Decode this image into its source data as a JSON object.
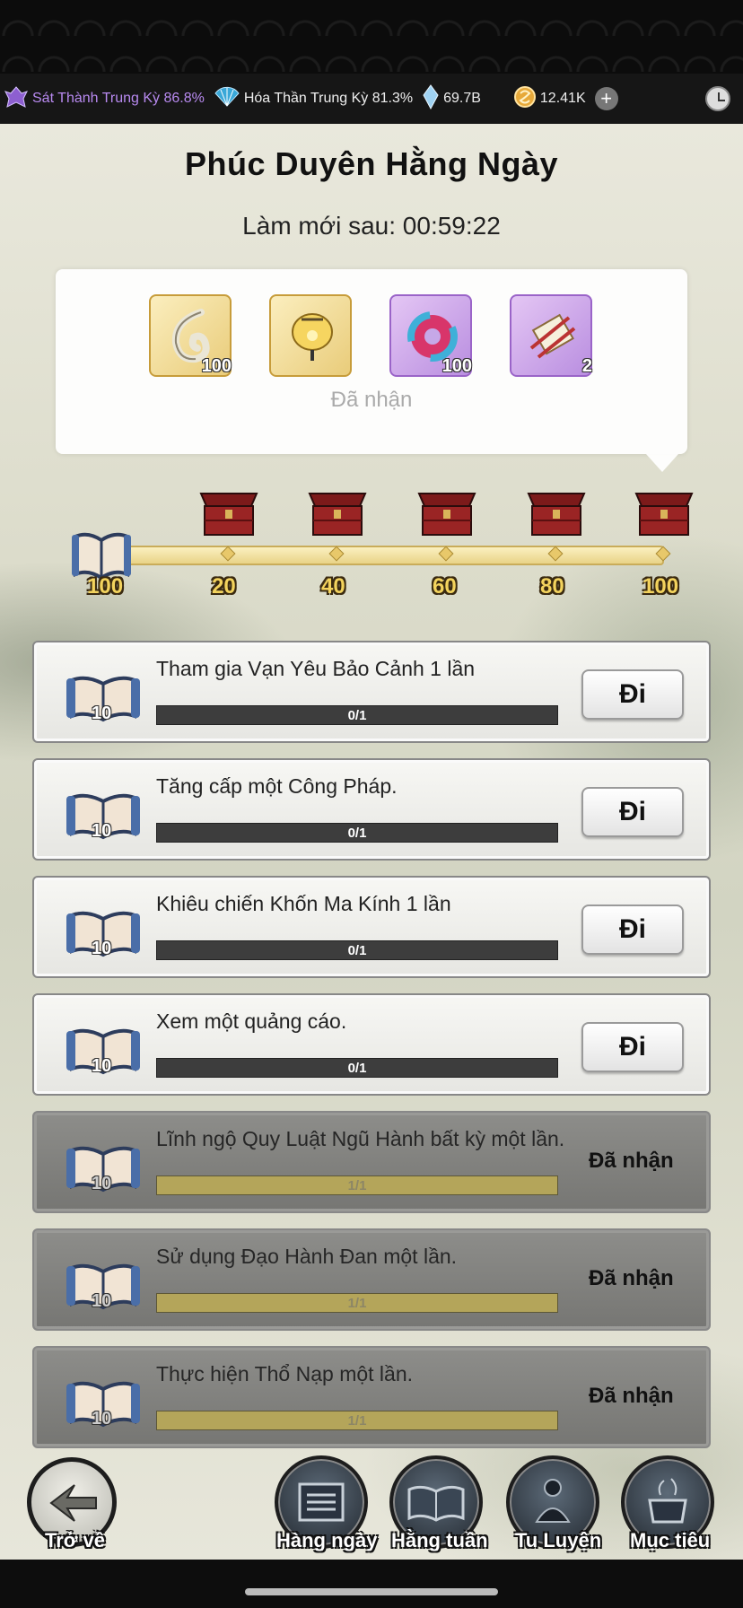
{
  "status_bar": {
    "buffs": [
      {
        "icon": "demon-icon",
        "label": "Sát Thành Trung Kỳ 86.8%",
        "color": "#b88af0"
      },
      {
        "icon": "fan-icon",
        "label": "Hóa Thần Trung Kỳ 81.3%",
        "color": "#eeeeee"
      }
    ],
    "crystal": "69.7B",
    "coin": "12.41K"
  },
  "page": {
    "title": "Phúc Duyên Hằng Ngày",
    "refresh_label": "Làm mới sau:  00:59:22"
  },
  "reward_panel": {
    "items": [
      {
        "icon": "hook-icon",
        "qty": "100",
        "rarity": "gold"
      },
      {
        "icon": "lantern-icon",
        "qty": "",
        "rarity": "gold"
      },
      {
        "icon": "ring-icon",
        "qty": "100",
        "rarity": "purple"
      },
      {
        "icon": "scroll-icon",
        "qty": "2",
        "rarity": "purple"
      }
    ],
    "status": "Đã nhận"
  },
  "progress": {
    "current": "100",
    "milestones": [
      "20",
      "40",
      "60",
      "80",
      "100"
    ],
    "fill_fraction": 1.0
  },
  "tasks": [
    {
      "text": "Tham gia Vạn Yêu Bảo Cảnh 1 lần",
      "reward": "10",
      "progress": "0/1",
      "action": "Đi",
      "done": false
    },
    {
      "text": "Tăng cấp một Công Pháp.",
      "reward": "10",
      "progress": "0/1",
      "action": "Đi",
      "done": false
    },
    {
      "text": "Khiêu chiến Khốn Ma Kính 1 lần",
      "reward": "10",
      "progress": "0/1",
      "action": "Đi",
      "done": false
    },
    {
      "text": "Xem một quảng cáo.",
      "reward": "10",
      "progress": "0/1",
      "action": "Đi",
      "done": false
    },
    {
      "text": "Lĩnh ngộ Quy Luật Ngũ Hành bất kỳ một lần.",
      "reward": "10",
      "progress": "1/1",
      "action": "Đã nhận",
      "done": true
    },
    {
      "text": "Sử dụng Đạo Hành Đan một lần.",
      "reward": "10",
      "progress": "1/1",
      "action": "Đã nhận",
      "done": true
    },
    {
      "text": "Thực hiện Thổ Nạp một lần.",
      "reward": "10",
      "progress": "1/1",
      "action": "Đã nhận",
      "done": true
    }
  ],
  "nav": {
    "back": "Trở về",
    "daily": "Hàng ngày",
    "weekly": "Hằng tuần",
    "cultivation": "Tu Luyện",
    "goal": "Mục tiêu"
  }
}
